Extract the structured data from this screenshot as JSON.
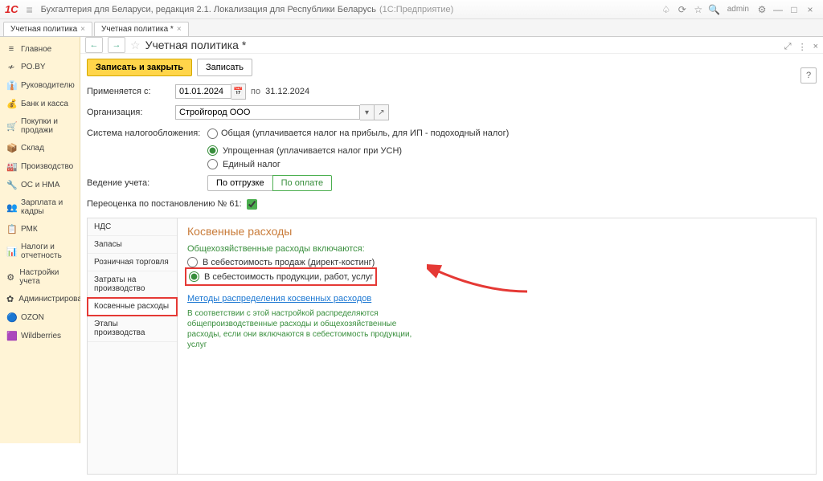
{
  "titlebar": {
    "logo": "1C",
    "title": "Бухгалтерия для Беларуси, редакция 2.1. Локализация для Республики Беларусь",
    "product": "(1С:Предприятие)",
    "user": "admin"
  },
  "tabs": [
    {
      "label": "Учетная политика"
    },
    {
      "label": "Учетная политика *"
    }
  ],
  "sidebar": [
    {
      "icon": "≡",
      "label": "Главное"
    },
    {
      "icon": "≁",
      "label": "PO.BY"
    },
    {
      "icon": "👔",
      "label": "Руководителю"
    },
    {
      "icon": "💰",
      "label": "Банк и касса"
    },
    {
      "icon": "🛒",
      "label": "Покупки и продажи"
    },
    {
      "icon": "📦",
      "label": "Склад"
    },
    {
      "icon": "🏭",
      "label": "Производство"
    },
    {
      "icon": "🔧",
      "label": "ОС и НМА"
    },
    {
      "icon": "👥",
      "label": "Зарплата и кадры"
    },
    {
      "icon": "📋",
      "label": "РМК"
    },
    {
      "icon": "📊",
      "label": "Налоги и отчетность"
    },
    {
      "icon": "⚙",
      "label": "Настройки учета"
    },
    {
      "icon": "✿",
      "label": "Администрирование"
    },
    {
      "icon": "🔵",
      "label": "OZON"
    },
    {
      "icon": "🟪",
      "label": "Wildberries"
    }
  ],
  "page": {
    "title": "Учетная политика *",
    "save_close": "Записать и закрыть",
    "save": "Записать",
    "help": "?"
  },
  "form": {
    "applied_from_label": "Применяется с:",
    "applied_from": "01.01.2024",
    "po": "по",
    "applied_to": "31.12.2024",
    "org_label": "Организация:",
    "org_value": "Стройгород ООО",
    "tax_label": "Система налогообложения:",
    "tax_opts": {
      "general": "Общая (уплачивается налог на прибыль, для ИП - подоходный налог)",
      "simplified": "Упрощенная (уплачивается налог при УСН)",
      "single": "Единый налог"
    },
    "accounting_label": "Ведение учета:",
    "acc_ship": "По отгрузке",
    "acc_pay": "По оплате",
    "reval_label": "Переоценка по постановлению № 61:"
  },
  "side_tabs": [
    "НДС",
    "Запасы",
    "Розничная торговля",
    "Затраты на производство",
    "Косвенные расходы",
    "Этапы производства"
  ],
  "panel": {
    "title": "Косвенные расходы",
    "green_label": "Общехозяйственные расходы включаются:",
    "opt1": "В себестоимость продаж (директ-костинг)",
    "opt2": "В себестоимость продукции, работ, услуг",
    "link": "Методы распределения косвенных расходов",
    "hint": "В соответствии с этой настройкой распределяются общепроизводственные расходы и общехозяйственные расходы, если они включаются в себестоимость продукции, услуг"
  }
}
